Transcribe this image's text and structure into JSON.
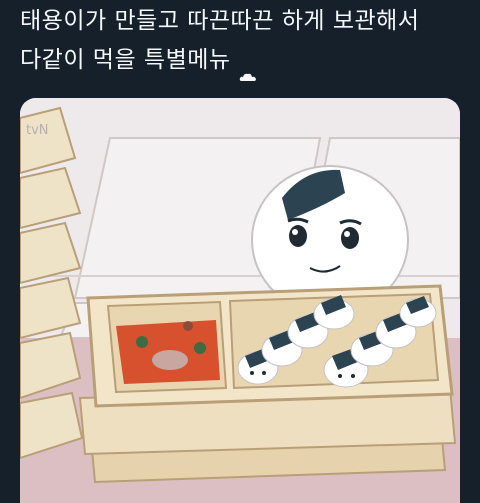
{
  "tweet": {
    "line1": "태용이가 만들고 따끈따끈 하게 보관해서",
    "line2": "다같이 먹을 특별메뉴",
    "trailing_icon": "cloud-icon"
  },
  "media": {
    "watermark": "tvN"
  },
  "colors": {
    "background": "#15202b",
    "text": "#f5f8fa",
    "tray": "#eedfc0",
    "tray_shadow": "#c9b48d",
    "table": "#dcbfc3",
    "soup": "#d8512f",
    "nori": "#2c4352"
  }
}
